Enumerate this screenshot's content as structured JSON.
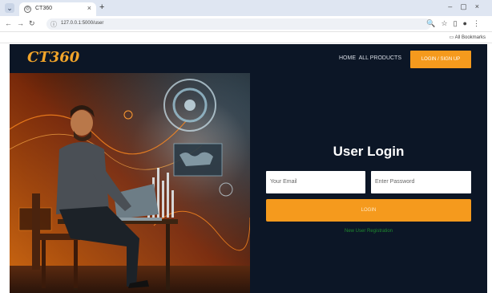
{
  "browser": {
    "tab_title": "CT360",
    "favicon": "globe-icon",
    "url": "127.0.0.1:5000/user",
    "bookmarks_label": "All Bookmarks"
  },
  "site": {
    "logo": "CT360",
    "nav": {
      "home": "HOME",
      "products": "ALL PRODUCTS",
      "login_signup": "LOGIN / SIGN UP"
    }
  },
  "login": {
    "title": "User Login",
    "email_placeholder": "Your Email",
    "password_placeholder": "Enter Password",
    "submit": "LOGIN",
    "register_link": "New User Registration"
  },
  "colors": {
    "page_bg": "#0c1626",
    "accent": "#f59a1d",
    "logo": "#f2a52a",
    "link_green": "#1e8a2e"
  }
}
